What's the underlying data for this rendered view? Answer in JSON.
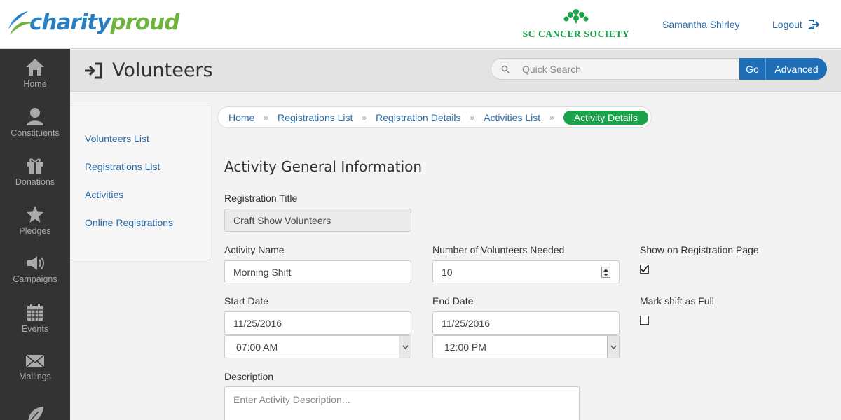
{
  "brand": {
    "logo_word1": "charity",
    "logo_word2": "proud",
    "org_name": "SC CANCER SOCIETY"
  },
  "header": {
    "user_name": "Samantha Shirley",
    "logout_label": "Logout"
  },
  "sidebar": {
    "items": [
      {
        "label": "Home",
        "icon": "home-icon"
      },
      {
        "label": "Constituents",
        "icon": "person-icon"
      },
      {
        "label": "Donations",
        "icon": "gift-icon"
      },
      {
        "label": "Pledges",
        "icon": "star-icon"
      },
      {
        "label": "Campaigns",
        "icon": "megaphone-icon"
      },
      {
        "label": "Events",
        "icon": "calendar-icon"
      },
      {
        "label": "Mailings",
        "icon": "envelope-icon"
      },
      {
        "label": "",
        "icon": "leaf-icon"
      }
    ]
  },
  "titlebar": {
    "page_title": "Volunteers",
    "search_placeholder": "Quick Search",
    "go_label": "Go",
    "advanced_label": "Advanced"
  },
  "subnav": {
    "items": [
      {
        "label": "Volunteers List"
      },
      {
        "label": "Registrations List"
      },
      {
        "label": "Activities"
      },
      {
        "label": "Online Registrations"
      }
    ]
  },
  "breadcrumb": {
    "items": [
      "Home",
      "Registrations List",
      "Registration Details",
      "Activities List"
    ],
    "active": "Activity Details",
    "separator": "»"
  },
  "form": {
    "section_title": "Activity General Information",
    "registration_title_label": "Registration Title",
    "registration_title_value": "Craft Show Volunteers",
    "activity_name_label": "Activity Name",
    "activity_name_value": "Morning Shift",
    "volunteers_needed_label": "Number of Volunteers Needed",
    "volunteers_needed_value": "10",
    "show_on_page_label": "Show on Registration Page",
    "show_on_page_checked": true,
    "start_date_label": "Start Date",
    "start_date_value": "11/25/2016",
    "start_time_value": "07:00 AM",
    "end_date_label": "End Date",
    "end_date_value": "11/25/2016",
    "end_time_value": "12:00 PM",
    "mark_full_label": "Mark shift as Full",
    "mark_full_checked": false,
    "description_label": "Description",
    "description_placeholder": "Enter Activity Description..."
  },
  "colors": {
    "brand_blue": "#2a7fc1",
    "brand_green": "#6fb43f",
    "active_green": "#1aa34a",
    "button_blue": "#1f6fb7",
    "sidebar_bg": "#333333"
  }
}
